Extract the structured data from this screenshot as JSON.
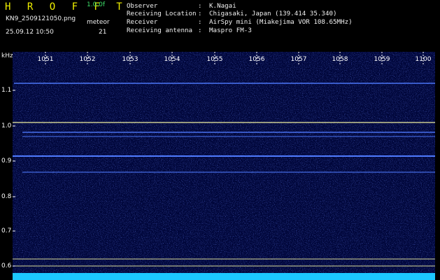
{
  "app": {
    "name": "H R O F F T",
    "version": "1.0.0f",
    "filename": "KN9_2509121050.png",
    "mode_label": "meteor",
    "timestamp": "25.09.12 10:50",
    "count": "21"
  },
  "info": [
    {
      "label": "Observer",
      "value": "K.Nagai"
    },
    {
      "label": "Receiving Location",
      "value": "Chigasaki, Japan (139.414 35.340)"
    },
    {
      "label": "Receiver",
      "value": "AirSpy mini (Miakejima VOR 108.65MHz)"
    },
    {
      "label": "Receiving antenna",
      "value": "Maspro FM-3"
    }
  ],
  "separator": ":",
  "axis": {
    "y_unit": "kHz",
    "x_ticks": [
      "1051",
      "1052",
      "1053",
      "1054",
      "1055",
      "1056",
      "1057",
      "1058",
      "1059",
      "1100"
    ],
    "y_ticks": [
      "1.1",
      "1.0",
      "0.9",
      "0.8",
      "0.7",
      "0.6"
    ]
  },
  "colors": {
    "title": "#f0f000",
    "accent": "#3ee06a",
    "background": "#000000",
    "spectrogram": "#00063a",
    "signal": "#4f7bff",
    "reference_line": "#f0f0a0",
    "noise_floor": "#1cc8ff"
  }
}
